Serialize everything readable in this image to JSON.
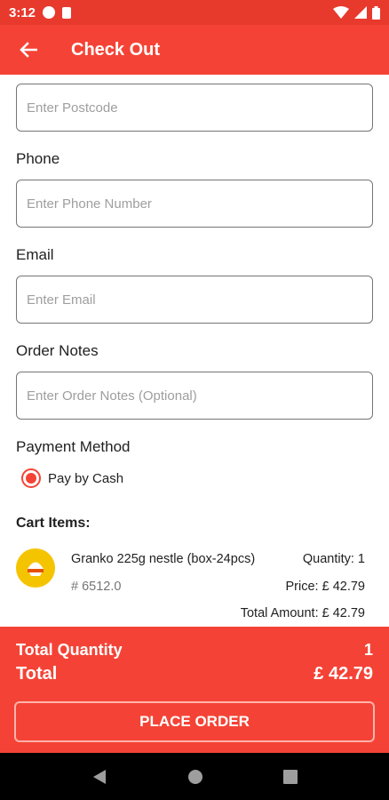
{
  "status_bar": {
    "time": "3:12"
  },
  "app_bar": {
    "title": "Check Out"
  },
  "form": {
    "postcode_placeholder": "Enter Postcode",
    "phone_label": "Phone",
    "phone_placeholder": "Enter Phone Number",
    "email_label": "Email",
    "email_placeholder": "Enter Email",
    "notes_label": "Order Notes",
    "notes_placeholder": "Enter Order Notes (Optional)",
    "payment_label": "Payment Method",
    "payment_option": "Pay by Cash"
  },
  "cart": {
    "title": "Cart Items:",
    "items": [
      {
        "name": "Granko 225g nestle (box-24pcs)",
        "code": "# 6512.0",
        "quantity": "Quantity: 1",
        "price": "Price:  £ 42.79",
        "total_amount": "Total Amount:  £ 42.79"
      }
    ]
  },
  "summary": {
    "total_quantity_label": "Total Quantity",
    "total_quantity_value": "1",
    "total_label": "Total",
    "total_value": "£ 42.79"
  },
  "place_order_label": "PLACE ORDER",
  "colors": {
    "primary": "#f44336",
    "status_bar": "#e8392d",
    "product_icon": "#f5c400"
  },
  "icons": [
    "back-arrow-icon",
    "wifi-icon",
    "signal-icon",
    "battery-icon",
    "nav-back-icon",
    "nav-home-icon",
    "nav-recents-icon"
  ]
}
